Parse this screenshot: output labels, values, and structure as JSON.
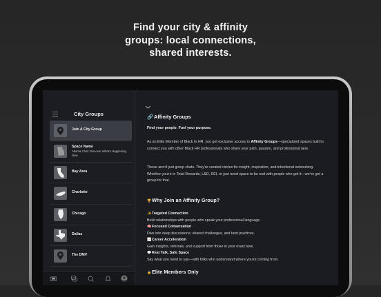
{
  "headline": {
    "line1": "Find your city & affinity",
    "line2": "groups: local connections,",
    "line3": "shared interests."
  },
  "sidebar": {
    "title": "City Groups",
    "items": [
      {
        "label": "Join A City Group",
        "icon": "location-pin-icon",
        "active": true
      },
      {
        "label": "Space Name",
        "subtitle": "Atlanta Chat: Discover What's Happening Now",
        "icon": "georgia-map-icon"
      },
      {
        "label": "Bay Area",
        "icon": "california-map-icon"
      },
      {
        "label": "Charlotte",
        "icon": "north-carolina-map-icon"
      },
      {
        "label": "Chicago",
        "icon": "illinois-map-icon"
      },
      {
        "label": "Dallas",
        "icon": "texas-map-icon"
      },
      {
        "label": "The DMV",
        "icon": "location-pin-icon"
      }
    ]
  },
  "tabbar": {
    "tabs": [
      "home-icon",
      "chat-icon",
      "search-icon",
      "bell-icon",
      "avatar-icon"
    ]
  },
  "main": {
    "title": "Affinity Groups",
    "title_icon": "link-icon",
    "tagline": "Find your people. Fuel your purpose.",
    "para1_a": "As an Elite Member of Black In HR, you get exclusive access to ",
    "para1_b": "Affinity Groups",
    "para1_c": "—specialized spaces built to connect you with other Black HR professionals who share your path, passion, and professional lane.",
    "para2": "These aren't just group chats. They're curated circles for insight, inspiration, and intentional networking. Whether you're in Total Rewards, L&D, DEI, or just need space to be real with people who get it—we've got a group for that.",
    "why_heading": "Why Join an Affinity Group?",
    "why_icon": "🏆",
    "benefits": [
      {
        "emoji": "✨",
        "title": "Targeted Connection",
        "text": "Build relationships with people who speak your professional language."
      },
      {
        "emoji": "🧠",
        "title": "Focused Conversation",
        "text": "Dive into deep discussions, shared challenges, and best practices."
      },
      {
        "emoji": "📈",
        "title": "Career Acceleration",
        "text": "Gain insights, referrals, and support from those in your exact lane."
      },
      {
        "emoji": "💬",
        "title": "Real Talk, Safe Space",
        "text": "Say what you need to say—with folks who understand where you're coming from."
      }
    ],
    "elite_heading": "Elite Members Only",
    "elite_icon": "🔒"
  },
  "colors": {
    "background": "#2a2a2a",
    "screen": "#1a1c21",
    "active_item": "#3a3d44"
  }
}
